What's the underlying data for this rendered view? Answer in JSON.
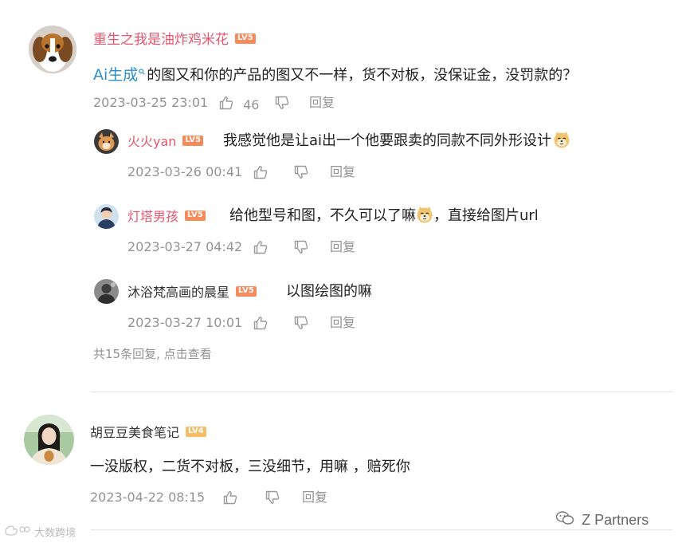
{
  "comments": [
    {
      "username": "重生之我是油炸鸡米花",
      "level": "LV5",
      "link_text": "Ai生成",
      "content": "的图又和你的产品的图又不一样，货不对板，没保证金，没罚款的？",
      "time": "2023-03-25 23:01",
      "likes": "46",
      "reply_label": "回复",
      "replies": [
        {
          "username": "火火yan",
          "level": "LV5",
          "content": "我感觉他是让ai出一个他要跟卖的同款不同外形设计",
          "emoji": "doge-emoji",
          "time": "2023-03-26 00:41",
          "reply_label": "回复"
        },
        {
          "username": "灯塔男孩",
          "level": "LV5",
          "content_before": "给他型号和图，不久可以了嘛",
          "emoji": "doge-emoji",
          "content_after": "，直接给图片url",
          "time": "2023-03-27 04:42",
          "reply_label": "回复"
        },
        {
          "username": "沐浴梵高画的晨星",
          "level": "LV5",
          "content": "以图绘图的嘛",
          "time": "2023-03-27 10:01",
          "reply_label": "回复"
        }
      ],
      "more_replies": "共15条回复, 点击查看"
    },
    {
      "username": "胡豆豆美食笔记",
      "level": "LV4",
      "content": "一没版权，二货不对板，三没细节，用嘛 ，赔死你",
      "time": "2023-04-22 08:15",
      "reply_label": "回复"
    }
  ],
  "watermark": {
    "left": "大数跨境",
    "right": "Z Partners"
  },
  "colors": {
    "username_main": "#e8556e",
    "level_badge_lv5": "#f58a5b",
    "level_badge_lv4": "#f6bc66",
    "link_blue": "#2a8fc9",
    "meta_gray": "#939393"
  }
}
